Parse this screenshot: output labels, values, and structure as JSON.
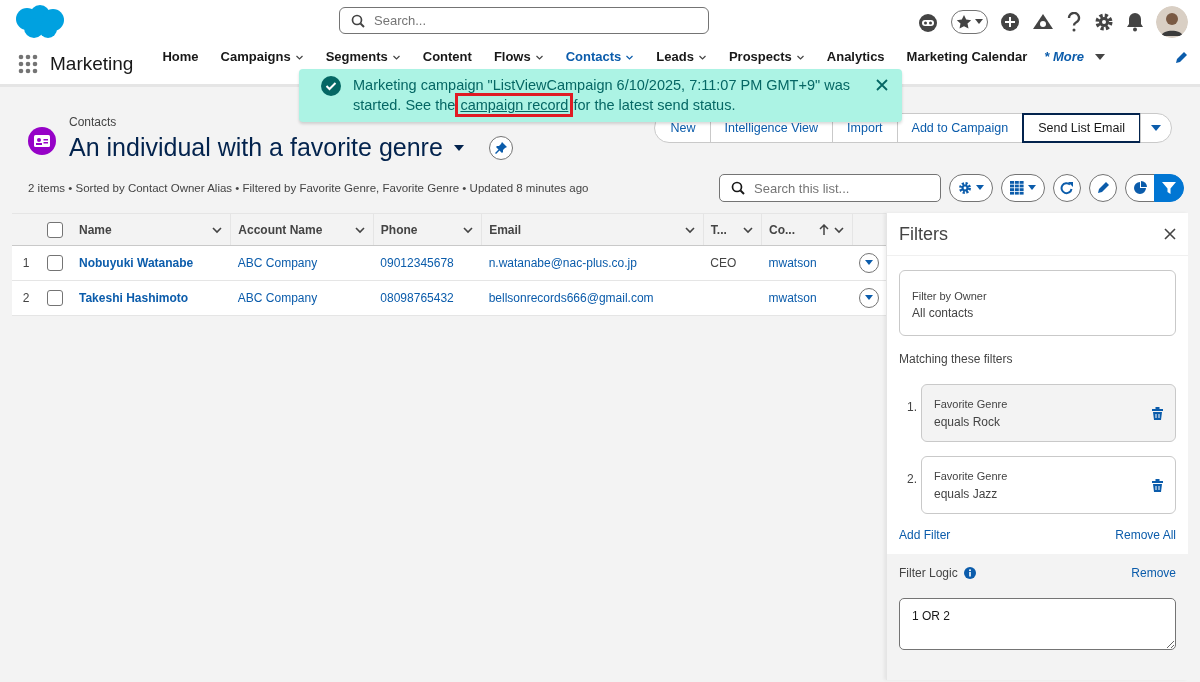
{
  "header": {
    "search_placeholder": "Search..."
  },
  "app": {
    "name": "Marketing",
    "nav": [
      {
        "label": "Home",
        "selected": false,
        "has_menu": false
      },
      {
        "label": "Campaigns",
        "selected": false,
        "has_menu": true
      },
      {
        "label": "Segments",
        "selected": false,
        "has_menu": true
      },
      {
        "label": "Content",
        "selected": false,
        "has_menu": false
      },
      {
        "label": "Flows",
        "selected": false,
        "has_menu": true
      },
      {
        "label": "Contacts",
        "selected": true,
        "has_menu": true
      },
      {
        "label": "Leads",
        "selected": false,
        "has_menu": true
      },
      {
        "label": "Prospects",
        "selected": false,
        "has_menu": true
      },
      {
        "label": "Analytics",
        "selected": false,
        "has_menu": false
      },
      {
        "label": "Marketing Calendar",
        "selected": false,
        "has_menu": false
      }
    ],
    "more": "* More"
  },
  "toast": {
    "before": "Marketing campaign \"ListViewCampaign 6/10/2025, 7:11:07 PM GMT+9\" was started. See the",
    "link": "campaign record",
    "after": "for the latest send status.",
    "link_highlighted": true
  },
  "list_header": {
    "object": "Contacts",
    "title": "An individual with a favorite genre",
    "actions": [
      {
        "label": "New",
        "focused": false
      },
      {
        "label": "Intelligence View",
        "focused": false
      },
      {
        "label": "Import",
        "focused": false
      },
      {
        "label": "Add to Campaign",
        "focused": false
      },
      {
        "label": "Send List Email",
        "focused": true
      }
    ],
    "meta": "2 items • Sorted by Contact Owner Alias • Filtered by Favorite Genre, Favorite Genre • Updated 8 minutes ago",
    "search_placeholder": "Search this list...",
    "filter_active": true
  },
  "table": {
    "select_all_checked": false,
    "columns": [
      {
        "label": "Name",
        "sorted": false
      },
      {
        "label": "Account Name",
        "sorted": false
      },
      {
        "label": "Phone",
        "sorted": false
      },
      {
        "label": "Email",
        "sorted": false
      },
      {
        "label": "T...",
        "sorted": false
      },
      {
        "label": "Co...",
        "sorted": true
      }
    ],
    "rows": [
      {
        "number": "1",
        "checked": false,
        "name": "Nobuyuki Watanabe",
        "account": "ABC Company",
        "phone": "09012345678",
        "email": "n.watanabe@nac-plus.co.jp",
        "title": "CEO",
        "owner": "mwatson"
      },
      {
        "number": "2",
        "checked": false,
        "name": "Takeshi Hashimoto",
        "account": "ABC Company",
        "phone": "08098765432",
        "email": "bellsonrecords666@gmail.com",
        "owner": "mwatson"
      }
    ]
  },
  "filters": {
    "title": "Filters",
    "owner_label": "Filter by Owner",
    "owner_value": "All contacts",
    "matching_label": "Matching these filters",
    "items": [
      {
        "number": "1.",
        "field": "Favorite Genre",
        "condition": "equals Rock",
        "selected": true
      },
      {
        "number": "2.",
        "field": "Favorite Genre",
        "condition": "equals Jazz",
        "selected": false
      }
    ],
    "add": "Add Filter",
    "remove_all": "Remove All",
    "logic_label": "Filter Logic",
    "logic_remove": "Remove",
    "logic_value": "1 OR 2"
  }
}
